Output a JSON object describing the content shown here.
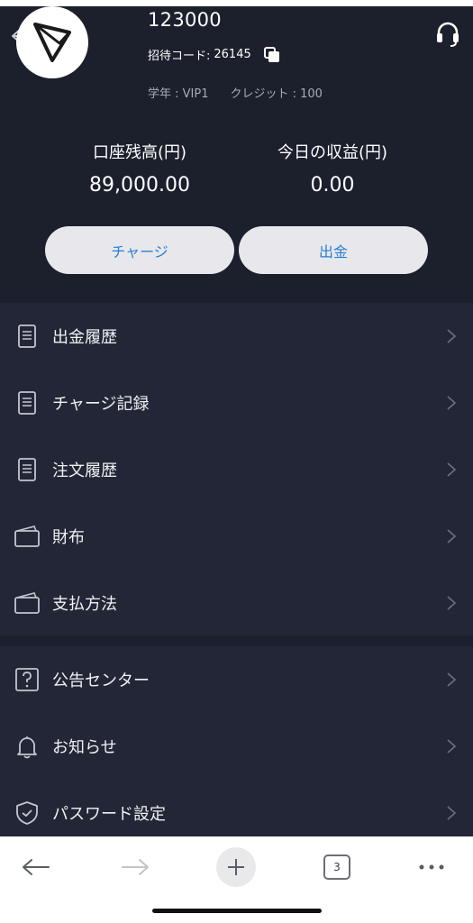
{
  "header": {
    "username": "123000",
    "invite_label": "招待コード:",
    "invite_code": "26145",
    "grade": "学年 : VIP1",
    "credit": "クレジット : 100"
  },
  "stats": {
    "balance_label": "口座残高(円)",
    "balance_value": "89,000.00",
    "profit_label": "今日の収益(円)",
    "profit_value": "0.00"
  },
  "actions": {
    "charge_label": "チャージ",
    "withdraw_label": "出金"
  },
  "menu_primary": [
    {
      "label": "出金履歴",
      "icon": "document-icon"
    },
    {
      "label": "チャージ記録",
      "icon": "document-icon"
    },
    {
      "label": "注文履歴",
      "icon": "document-icon"
    },
    {
      "label": "財布",
      "icon": "wallet-icon"
    },
    {
      "label": "支払方法",
      "icon": "wallet-icon"
    }
  ],
  "menu_secondary": [
    {
      "label": "公告センター",
      "icon": "help-icon"
    },
    {
      "label": "お知らせ",
      "icon": "bell-icon"
    },
    {
      "label": "パスワード設定",
      "icon": "shield-icon"
    }
  ],
  "browser_bar": {
    "tab_count": "3"
  },
  "colors": {
    "header_bg": "#1c1f2c",
    "menu_bg": "#232636",
    "accent": "#2a7fd2",
    "button_bg": "#e8e8ec"
  }
}
